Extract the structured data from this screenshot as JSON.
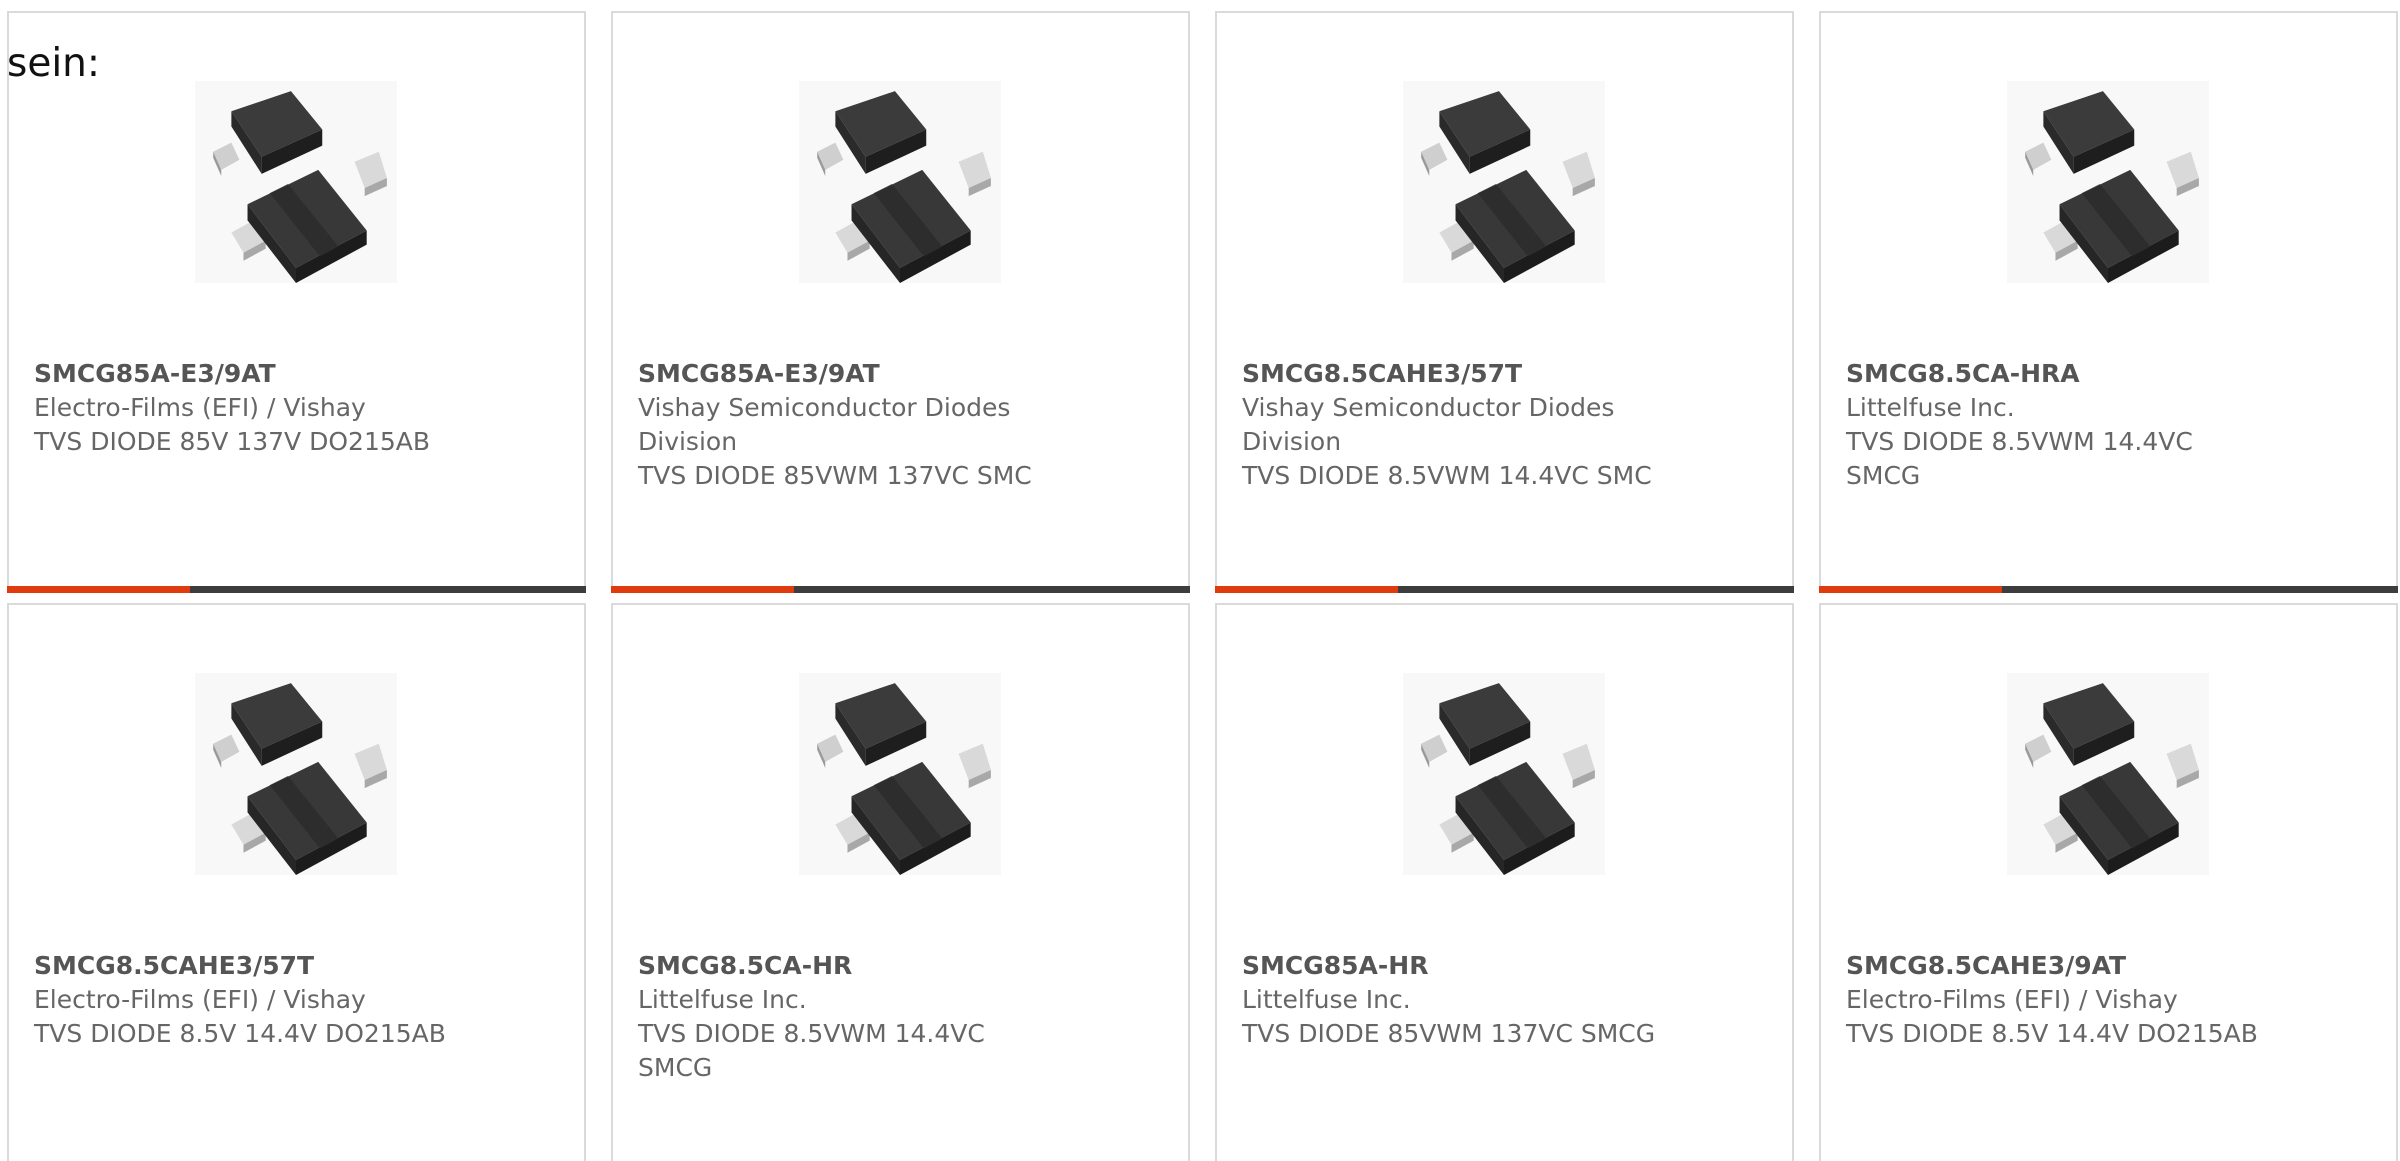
{
  "intro_text": "sein:",
  "colors": {
    "accent": "#e03a0f",
    "bar": "#3d3d3d",
    "border": "#dadada",
    "text": "#666666"
  },
  "product_icon": "smc-diode-package-icon",
  "products": [
    {
      "part_number": "SMCG85A-E3/9AT",
      "manufacturer": "Electro-Films (EFI) / Vishay",
      "description": "TVS DIODE 85V 137V DO215AB"
    },
    {
      "part_number": "SMCG85A-E3/9AT",
      "manufacturer": "Vishay Semiconductor Diodes Division",
      "description": "TVS DIODE 85VWM 137VC SMC"
    },
    {
      "part_number": "SMCG8.5CAHE3/57T",
      "manufacturer": "Vishay Semiconductor Diodes Division",
      "description": "TVS DIODE 8.5VWM 14.4VC SMC"
    },
    {
      "part_number": "SMCG8.5CA-HRA",
      "manufacturer": "Littelfuse Inc.",
      "description": "TVS DIODE 8.5VWM 14.4VC SMCG"
    },
    {
      "part_number": "SMCG8.5CAHE3/57T",
      "manufacturer": "Electro-Films (EFI) / Vishay",
      "description": "TVS DIODE 8.5V 14.4V DO215AB"
    },
    {
      "part_number": "SMCG8.5CA-HR",
      "manufacturer": "Littelfuse Inc.",
      "description": "TVS DIODE 8.5VWM 14.4VC SMCG"
    },
    {
      "part_number": "SMCG85A-HR",
      "manufacturer": "Littelfuse Inc.",
      "description": "TVS DIODE 85VWM 137VC SMCG"
    },
    {
      "part_number": "SMCG8.5CAHE3/9AT",
      "manufacturer": "Electro-Films (EFI) / Vishay",
      "description": "TVS DIODE 8.5V 14.4V DO215AB"
    }
  ]
}
